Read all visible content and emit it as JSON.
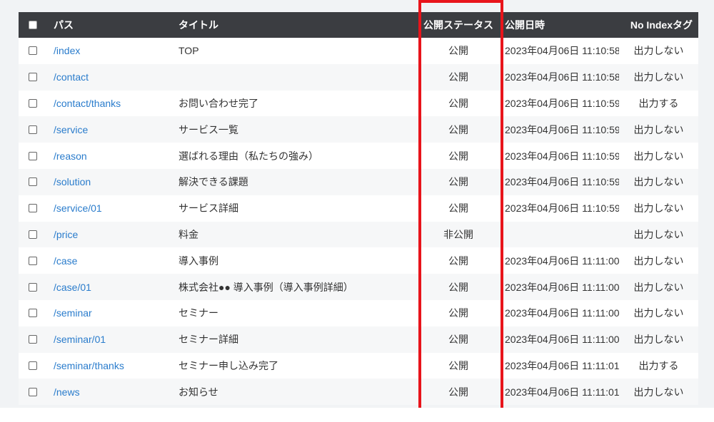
{
  "header": {
    "path": "パス",
    "title": "タイトル",
    "status": "公開ステータス",
    "date": "公開日時",
    "noindex": "No Indexタグ"
  },
  "rows": [
    {
      "path": "/index",
      "title": "TOP",
      "status": "公開",
      "date": "2023年04月06日 11:10:58",
      "noindex": "出力しない"
    },
    {
      "path": "/contact",
      "title": "",
      "status": "公開",
      "date": "2023年04月06日 11:10:58",
      "noindex": "出力しない"
    },
    {
      "path": "/contact/thanks",
      "title": "お問い合わせ完了",
      "status": "公開",
      "date": "2023年04月06日 11:10:59",
      "noindex": "出力する"
    },
    {
      "path": "/service",
      "title": "サービス一覧",
      "status": "公開",
      "date": "2023年04月06日 11:10:59",
      "noindex": "出力しない"
    },
    {
      "path": "/reason",
      "title": "選ばれる理由（私たちの強み）",
      "status": "公開",
      "date": "2023年04月06日 11:10:59",
      "noindex": "出力しない"
    },
    {
      "path": "/solution",
      "title": "解決できる課題",
      "status": "公開",
      "date": "2023年04月06日 11:10:59",
      "noindex": "出力しない"
    },
    {
      "path": "/service/01",
      "title": "サービス詳細",
      "status": "公開",
      "date": "2023年04月06日 11:10:59",
      "noindex": "出力しない"
    },
    {
      "path": "/price",
      "title": "料金",
      "status": "非公開",
      "date": "",
      "noindex": "出力しない"
    },
    {
      "path": "/case",
      "title": "導入事例",
      "status": "公開",
      "date": "2023年04月06日 11:11:00",
      "noindex": "出力しない"
    },
    {
      "path": "/case/01",
      "title": "株式会社●● 導入事例（導入事例詳細）",
      "status": "公開",
      "date": "2023年04月06日 11:11:00",
      "noindex": "出力しない"
    },
    {
      "path": "/seminar",
      "title": "セミナー",
      "status": "公開",
      "date": "2023年04月06日 11:11:00",
      "noindex": "出力しない"
    },
    {
      "path": "/seminar/01",
      "title": "セミナー詳細",
      "status": "公開",
      "date": "2023年04月06日 11:11:00",
      "noindex": "出力しない"
    },
    {
      "path": "/seminar/thanks",
      "title": "セミナー申し込み完了",
      "status": "公開",
      "date": "2023年04月06日 11:11:01",
      "noindex": "出力する"
    },
    {
      "path": "/news",
      "title": "お知らせ",
      "status": "公開",
      "date": "2023年04月06日 11:11:01",
      "noindex": "出力しない"
    }
  ],
  "colors": {
    "header_bg": "#3b3d41",
    "link": "#2a7ccc",
    "highlight": "#e8141b"
  }
}
